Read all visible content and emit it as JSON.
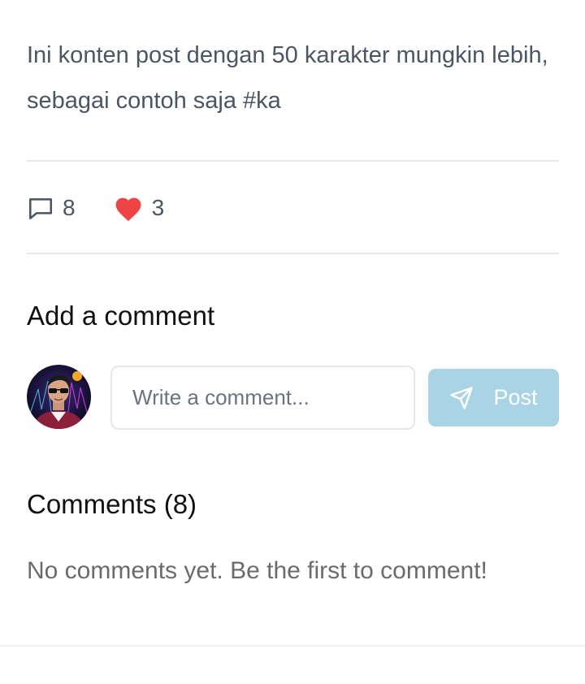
{
  "post": {
    "content": "Ini konten post dengan 50 karakter mungkin lebih, sebagai contoh saja #ka",
    "comment_count": "8",
    "like_count": "3"
  },
  "add_comment": {
    "title": "Add a comment",
    "placeholder": "Write a comment...",
    "post_label": "Post"
  },
  "comments": {
    "title": "Comments (8)",
    "empty_text": "No comments yet. Be the first to comment!"
  },
  "icons": {
    "comment": "comment-bubble-icon",
    "like": "heart-icon",
    "send": "send-icon"
  },
  "colors": {
    "heart": "#ef4444",
    "post_button_bg": "#a8d4e6",
    "divider": "#e5e7eb"
  }
}
